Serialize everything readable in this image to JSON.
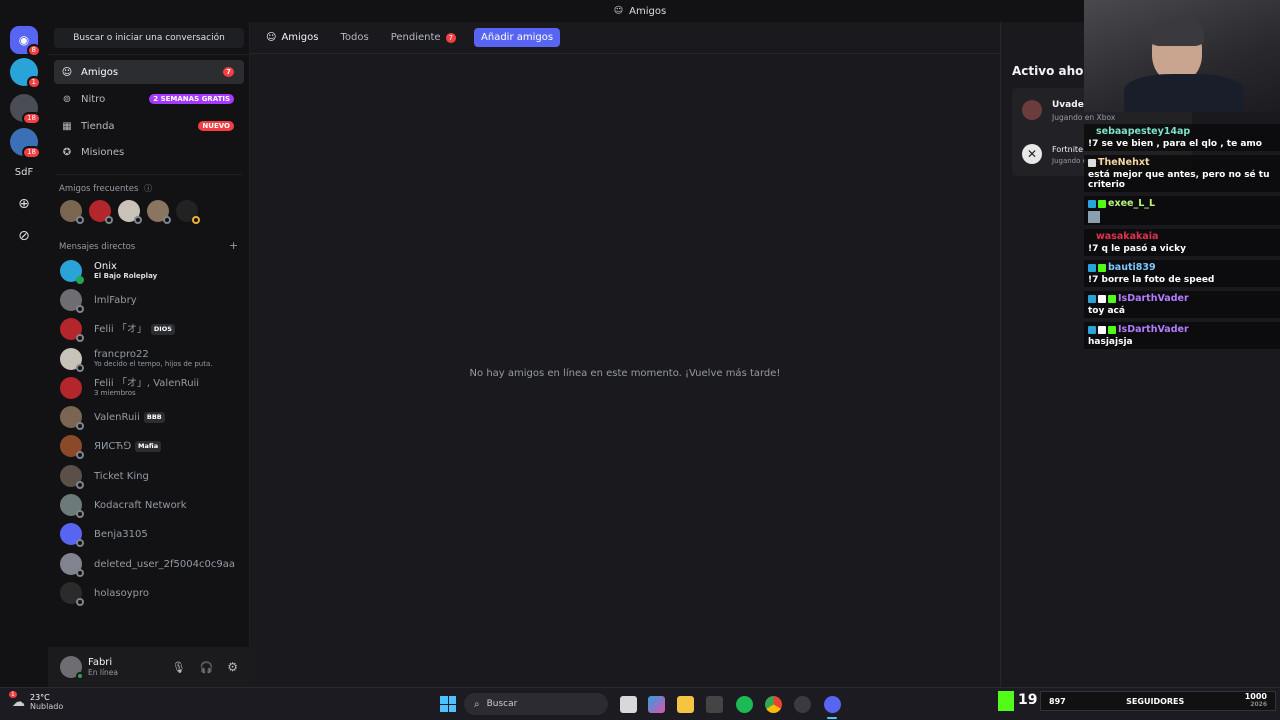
{
  "window": {
    "title": "Amigos"
  },
  "servers": [
    {
      "name": "discord-home",
      "badge": "8"
    },
    {
      "name": "server-1",
      "badge": "1"
    },
    {
      "name": "server-2",
      "badge": "18"
    },
    {
      "name": "server-3",
      "badge": "18"
    },
    {
      "name": "server-sdf",
      "label": "SdF"
    }
  ],
  "sidebar": {
    "search": "Buscar o iniciar una conversación",
    "nav": [
      {
        "label": "Amigos",
        "pill": "7"
      },
      {
        "label": "Nitro",
        "pill": "2 SEMANAS GRATIS"
      },
      {
        "label": "Tienda",
        "pill": "NUEVO"
      },
      {
        "label": "Misiones"
      }
    ],
    "frequent_title": "Amigos frecuentes",
    "dm_title": "Mensajes directos",
    "dms": [
      {
        "name": "Onix",
        "sub": "El Bajo Roleplay"
      },
      {
        "name": "lmlFabry"
      },
      {
        "name": "Felii 「オ」",
        "tag": "DIOS"
      },
      {
        "name": "francpro22",
        "sub": "Yo decido el tempo, hijos de puta."
      },
      {
        "name": "Felii 「オ」, ValenRuii",
        "sub": "3 miembros"
      },
      {
        "name": "ValenRuii",
        "tag": "BBB"
      },
      {
        "name": "ЯИCЋ⅁",
        "tag": "Mafia"
      },
      {
        "name": "Ticket King"
      },
      {
        "name": "Kodacraft Network"
      },
      {
        "name": "Benja3105"
      },
      {
        "name": "deleted_user_2f5004c0c9aa"
      },
      {
        "name": "holasoypro"
      }
    ],
    "user": {
      "name": "Fabri",
      "status": "En línea"
    }
  },
  "main": {
    "tabs": {
      "friends": "Amigos",
      "all": "Todos",
      "pending": "Pendiente",
      "pending_count": "7",
      "add": "Añadir amigos"
    },
    "empty_text": "No hay amigos en línea en este momento. ¡Vuelve más tarde!"
  },
  "active_now": {
    "title": "Activo ahora",
    "items": [
      {
        "name": "Uvadec",
        "sub": "Jugando en Xbox"
      },
      {
        "name": "Fortnite",
        "sub": "Jugando en Xbox"
      }
    ]
  },
  "stream_chat": [
    {
      "user": "sebaapestey14ap",
      "color": "#7de3c8",
      "text": "!7 se ve bien , para el qlo , te amo"
    },
    {
      "user": "TheNehxt",
      "color": "#f3d6a0",
      "text": "está mejor que antes, pero no sé tu criterio"
    },
    {
      "user": "exee_L_L",
      "color": "#b9f27c",
      "text": ""
    },
    {
      "user": "wasakakaia",
      "color": "#e0334f",
      "text": "!7 q le pasó a vicky"
    },
    {
      "user": "bauti839",
      "color": "#7cc8ff",
      "text": "!7 borre la foto de speed"
    },
    {
      "user": "IsDarthVader",
      "color": "#b57cff",
      "text": "toy acá"
    },
    {
      "user": "IsDarthVader",
      "color": "#b57cff",
      "text": "hasjajsja"
    }
  ],
  "taskbar": {
    "weather_temp": "23°C",
    "weather_desc": "Nublado",
    "weather_alert": "1",
    "search": "Buscar",
    "kick_count": "19",
    "followers_count": "897",
    "followers_label": "SEGUIDORES",
    "followers_goal": "1000",
    "followers_year": "2026"
  },
  "colors": {
    "accent": "#5865f2",
    "badge": "#f23f43",
    "nitro": "#a63bff"
  }
}
